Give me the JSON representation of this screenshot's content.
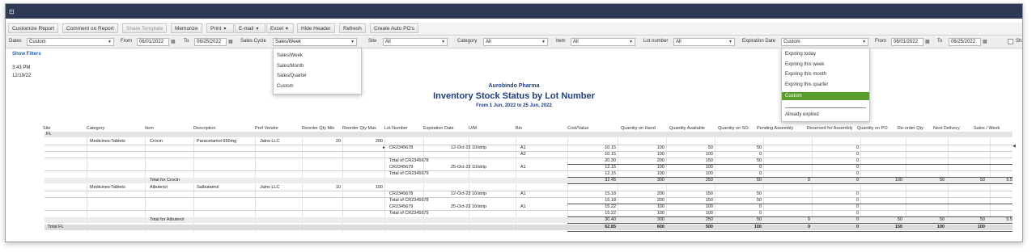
{
  "toolbar": {
    "customize_report": "Customize Report",
    "comment_on_report": "Comment on Report",
    "share_template": "Share Template",
    "memorize": "Memorize",
    "print": "Print",
    "email": "E-mail",
    "excel": "Excel",
    "hide_header": "Hide Header",
    "refresh": "Refresh",
    "create_auto_pos": "Create Auto PO's"
  },
  "filters": {
    "dates_label": "Dates",
    "dates_value": "Custom",
    "from_label": "From",
    "from_value": "06/01/2022",
    "to_label": "To",
    "to_value": "06/25/2022",
    "sales_cycle_label": "Sales Cycle",
    "sales_cycle_value": "Sales/Week",
    "site_label": "Site",
    "site_value": "All",
    "category_label": "Category",
    "category_value": "All",
    "item_label": "Item",
    "item_value": "All",
    "lot_label": "Lot number",
    "lot_value": "All",
    "exp_label": "Expiration Date",
    "exp_value": "Custom",
    "exp_from_label": "From",
    "exp_from_value": "06/01/2022",
    "exp_to_label": "To",
    "exp_to_value": "06/25/2022",
    "trailing_label": "Sh"
  },
  "left": {
    "show_filters": "Show Filters",
    "time": "3:43 PM",
    "date": "12/19/22"
  },
  "report": {
    "company": "Aurobindo Pharma",
    "title": "Inventory Stock Status by Lot Number",
    "subtitle": "From 1 Jun, 2022 to 25 Jun, 2022"
  },
  "sales_cycle_options": [
    "Sales/Week",
    "Sales/Month",
    "Sales/Quarter",
    "Custom"
  ],
  "expiration_options": [
    "Expiring today",
    "Expiring this week",
    "Expiring this month",
    "Expiring this quarter",
    "Custom",
    "",
    "Already expired"
  ],
  "expiration_selected_index": 4,
  "columns": {
    "site": "Site",
    "category": "Category",
    "item": "Item",
    "description": "Description",
    "pref_vendor": "Pref Vendor",
    "reorder_min": "Reorder Qty Min",
    "reorder_max": "Reorder Qty Max",
    "lot_number": "Lot Number",
    "expiration_date": "Expiration Date",
    "um": "U/M",
    "bin": "Bin",
    "cost_value": "Cost/Value",
    "qty_on_hand": "Quantity on Hand",
    "qty_available": "Quantity Available",
    "qty_on_so": "Quantity on SO",
    "pending_assembly": "Pending Assembly",
    "reserved_assembly": "Reserved for Assembly",
    "qty_on_po": "Quantity on PO",
    "reorder_qty": "Re-order Qty",
    "next_delivery": "Next Delivery",
    "sales_week": "Sales / Week"
  },
  "group": {
    "site": "FL",
    "total_label": "Total FL"
  },
  "items": [
    {
      "category": "Medicines:Tablets",
      "item": "Crocin",
      "description": "Paracetamol 650mg",
      "vendor": "Jains LLC",
      "min": "20",
      "max": "200",
      "rows": [
        {
          "lot": "CR2345678",
          "exp": "12-Oct-23",
          "um": "10/strip",
          "bin": "A1",
          "cost": "10.15",
          "onhand": "100",
          "avail": "50",
          "so": "50",
          "reserved": "0"
        },
        {
          "lot": "",
          "exp": "",
          "um": "",
          "bin": "A2",
          "cost": "10.15",
          "onhand": "100",
          "avail": "100",
          "so": "0",
          "reserved": "0"
        },
        {
          "lot": "Total of CR2345678",
          "exp": "",
          "um": "",
          "bin": "",
          "cost": "20.30",
          "onhand": "200",
          "avail": "150",
          "so": "50",
          "reserved": "0"
        },
        {
          "lot": "CR2345679",
          "exp": "25-Oct-23",
          "um": "10/strip",
          "bin": "A1",
          "cost": "12.15",
          "onhand": "100",
          "avail": "100",
          "so": "0",
          "reserved": "0"
        },
        {
          "lot": "Total of CR2345679",
          "exp": "",
          "um": "",
          "bin": "",
          "cost": "12.15",
          "onhand": "100",
          "avail": "100",
          "so": "0",
          "reserved": "0"
        }
      ],
      "total": {
        "label": "Total for Crocin",
        "cost": "32.45",
        "onhand": "300",
        "avail": "250",
        "so": "50",
        "pending": "0",
        "reserved": "0",
        "po": "100",
        "reorder": "50",
        "next": "50",
        "sales": "5.5"
      }
    },
    {
      "category": "Medicines:Tablets",
      "item": "Albuterol",
      "description": "Salbutamol",
      "vendor": "Jains LLC",
      "min": "10",
      "max": "100",
      "rows": [
        {
          "lot": "CR2345678",
          "exp": "12-Oct-23",
          "um": "10/strip",
          "bin": "A1",
          "cost": "15.18",
          "onhand": "200",
          "avail": "150",
          "so": "50",
          "reserved": "0"
        },
        {
          "lot": "Total of CR2345678",
          "exp": "",
          "um": "",
          "bin": "",
          "cost": "15.18",
          "onhand": "200",
          "avail": "150",
          "so": "50",
          "reserved": "0"
        },
        {
          "lot": "CR2345679",
          "exp": "25-Oct-23",
          "um": "10/strip",
          "bin": "A1",
          "cost": "15.22",
          "onhand": "100",
          "avail": "100",
          "so": "0",
          "reserved": "0"
        },
        {
          "lot": "Total of CR2345679",
          "exp": "",
          "um": "",
          "bin": "",
          "cost": "15.22",
          "onhand": "100",
          "avail": "100",
          "so": "0",
          "reserved": "0"
        }
      ],
      "total": {
        "label": "Total for Albuterol",
        "cost": "30.40",
        "onhand": "300",
        "avail": "250",
        "so": "50",
        "pending": "0",
        "reserved": "0",
        "po": "50",
        "reorder": "50",
        "next": "50",
        "sales": "5.5"
      }
    }
  ],
  "grand_total": {
    "cost": "62.85",
    "onhand": "600",
    "avail": "500",
    "so": "100",
    "pending": "0",
    "reserved": "0",
    "po": "150",
    "reorder": "100",
    "next": "100"
  }
}
